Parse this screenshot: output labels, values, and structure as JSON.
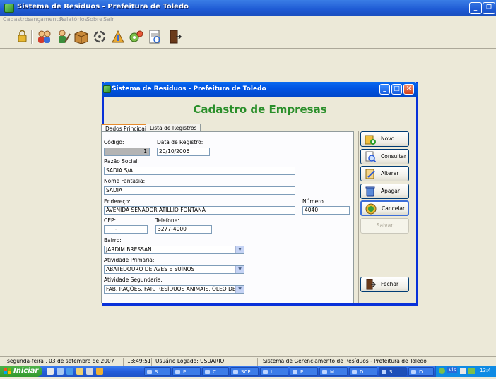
{
  "main_window": {
    "title": "Sistema de Residuos - Prefeitura de Toledo",
    "menu": [
      "Cadastros",
      "Lançamentos",
      "Relatórios",
      "Sobre",
      "Sair"
    ]
  },
  "toolbar": {
    "icons": [
      "lock-icon",
      "users-icon",
      "worker-icon",
      "package-icon",
      "recycle-icon",
      "tools-icon",
      "gears-icon",
      "report-icon",
      "exit-icon"
    ]
  },
  "dialog": {
    "title": "Sistema de Residuos - Prefeitura de Toledo",
    "heading": "Cadastro de Empresas",
    "tabs": [
      "Dados Principais",
      "Lista de Registros"
    ],
    "fields": {
      "codigo": {
        "label": "Código:",
        "value": "1"
      },
      "data_registro": {
        "label": "Data de Registro:",
        "value": "20/10/2006"
      },
      "razao_social": {
        "label": "Razão Social:",
        "value": "SADIA S/A"
      },
      "nome_fantasia": {
        "label": "Nome Fantasia:",
        "value": "SADIA"
      },
      "endereco": {
        "label": "Endereço:",
        "value": "AVENIDA SENADOR ATÍLLIO FONTANA"
      },
      "numero": {
        "label": "Número",
        "value": "4040"
      },
      "cep": {
        "label": "CEP:",
        "value": "  -"
      },
      "telefone": {
        "label": "Telefone:",
        "value": "3277-4000"
      },
      "bairro": {
        "label": "Bairro:",
        "value": "JARDIM BRESSAN"
      },
      "atividade_primaria": {
        "label": "Atividade Primaria:",
        "value": "ABATEDOURO DE AVES E SUÍNOS"
      },
      "atividade_segundaria": {
        "label": "Atividade Segundaria:",
        "value": "FAB. RAÇÕES, FAR. RESÍDUOS ANIMAIS, ÓLEO DEGOI"
      }
    },
    "buttons": {
      "novo": "Novo",
      "consultar": "Consultar",
      "alterar": "Alterar",
      "apagar": "Apagar",
      "cancelar": "Cancelar",
      "salvar": "Salvar",
      "fechar": "Fechar"
    }
  },
  "statusbar": {
    "date": "segunda-feira , 03 de setembro de 2007",
    "time": "13:49:51",
    "user": "Usuário Logado: USUARIO",
    "system": "Sistema de Gerenciamento de Resíduos - Prefeitura de Toledo"
  },
  "taskbar": {
    "start": "Iniciar",
    "tasks": [
      "S...",
      "P...",
      "C...",
      "SCP",
      "I...",
      "P...",
      "M...",
      "D...",
      "S...",
      "D..."
    ],
    "tray_text": "Vis",
    "clock": "13:4"
  },
  "colors": {
    "title_bar": "#0054e3",
    "heading_green": "#2a8f2a",
    "window_bg": "#ece9d8",
    "start_green": "#339a2e"
  }
}
